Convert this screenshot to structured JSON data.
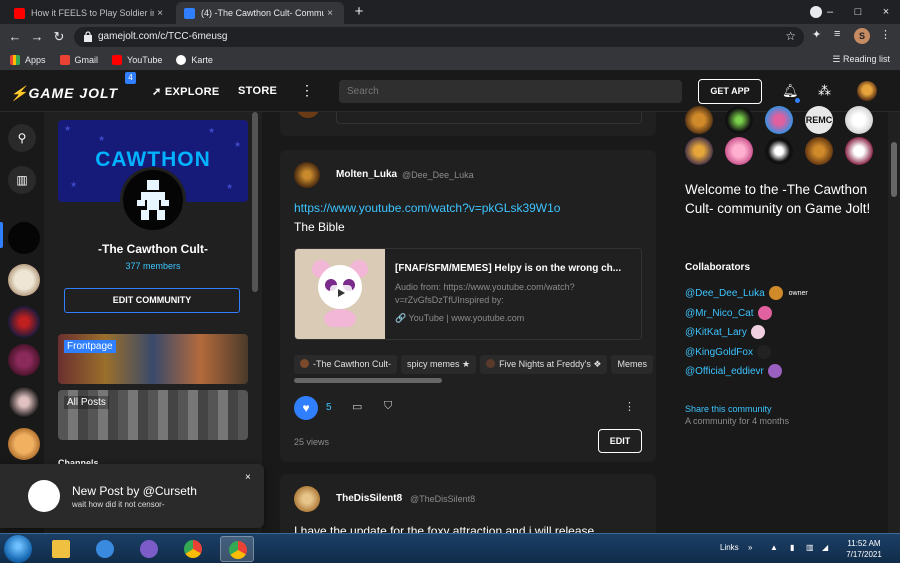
{
  "browser": {
    "tabs": [
      {
        "title": "How it FEELS to Play Soldier in TF2",
        "close": "×"
      },
      {
        "title": "(4) -The Cawthon Cult- Commu",
        "close": "×"
      }
    ],
    "new_tab": "+",
    "url": "gamejolt.com/c/TCC-6meusg",
    "bookmarks": [
      "Apps",
      "Gmail",
      "YouTube",
      "Karte"
    ],
    "reading_list": "Reading list",
    "profile_initial": "S",
    "window_controls": [
      "–",
      "□",
      "×"
    ]
  },
  "header": {
    "logo": "GAME JOLT",
    "logo_badge": "4",
    "explore": "EXPLORE",
    "store": "STORE",
    "search_placeholder": "Search",
    "get_app": "GET APP"
  },
  "community": {
    "banner_text": "CAWTHON",
    "name": "-The Cawthon Cult-",
    "members": "377 members",
    "edit_button": "EDIT COMMUNITY",
    "channels": [
      {
        "label": "Frontpage"
      },
      {
        "label": "All Posts"
      }
    ],
    "channels_heading": "Channels"
  },
  "post": {
    "author": "Molten_Luka",
    "handle": "@Dee_Dee_Luka",
    "link": "https://www.youtube.com/watch?v=pkGLsk39W1o",
    "body": "The Bible",
    "embed": {
      "title": "[FNAF/SFM/MEMES] Helpy is on the wrong ch...",
      "desc": "Audio from: https://www.youtube.com/watch?v=rZvGfsDzTfUInspired by:",
      "source": "YouTube | www.youtube.com"
    },
    "tags": [
      "-The Cawthon Cult-",
      "spicy memes ★",
      "Five Nights at Freddy's ❖",
      "Memes"
    ],
    "likes": "5",
    "views": "25 views",
    "edit": "EDIT"
  },
  "next_post": {
    "author": "TheDisSilent8",
    "handle": "@TheDisSilent8",
    "body": "I have the update for the foxy attraction and i will release"
  },
  "right": {
    "welcome": "Welcome to the -The Cawthon Cult- community on Game Jolt!",
    "member_label_partial": "REMC",
    "collab_heading": "Collaborators",
    "collaborators": [
      {
        "name": "@Dee_Dee_Luka",
        "owner": "owner"
      },
      {
        "name": "@Mr_Nico_Cat"
      },
      {
        "name": "@KitKat_Lary"
      },
      {
        "name": "@KingGoldFox"
      },
      {
        "name": "@Official_eddievr"
      }
    ],
    "share": "Share this community",
    "age": "A community for 4 months"
  },
  "toast": {
    "title": "New Post by @Curseth",
    "body": "wait how did it not censor-",
    "close": "×"
  },
  "taskbar": {
    "links": "Links",
    "time": "11:52 AM",
    "date": "7/17/2021"
  },
  "colors": {
    "accent_blue": "#2f7fff",
    "link_cyan": "#3dc4ff",
    "background": "#191919",
    "card": "#202020"
  }
}
